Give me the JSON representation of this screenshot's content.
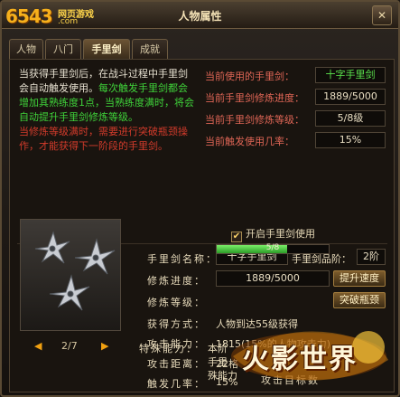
{
  "titlebar": {
    "logo_text": "6543",
    "logo_sub": "网页游戏",
    "logo_com": ".com",
    "title": "人物属性",
    "close_label": "✕"
  },
  "tabs": [
    {
      "label": "人物",
      "active": false
    },
    {
      "label": "八门",
      "active": false
    },
    {
      "label": "手里剑",
      "active": true
    },
    {
      "label": "成就",
      "active": false
    }
  ],
  "description": {
    "white": "当获得手里剑后，在战斗过程中手里剑会自动触发使用。",
    "green": "每次触发手里剑都会增加其熟练度1点，当熟练度满时，将会自动提升手里剑修炼等级。",
    "red": "当修炼等级满时，需要进行突破瓶颈操作，才能获得下一阶段的手里剑。"
  },
  "current": {
    "name_label": "当前使用的手里剑：",
    "name_value": "十字手里剑",
    "progress_label": "当前手里剑修炼进度：",
    "progress_value": "1889/5000",
    "level_label": "当前手里剑修炼等级：",
    "level_value": "5/8级",
    "trigger_label": "当前触发使用几率：",
    "trigger_value": "15%"
  },
  "enable_checkbox": {
    "checked": true,
    "label": "开启手里剑使用"
  },
  "detail": {
    "name_label": "手里剑名称：",
    "name_value": "十字手里剑",
    "grade_label": "手里剑品阶：",
    "grade_value": "2阶",
    "progress_label": "修炼进度：",
    "progress_value": "1889/5000",
    "speedup_button": "提升速度",
    "level_label": "修炼等级：",
    "level_value": "5/8",
    "level_fraction": 0.625,
    "breakthrough_button": "突破瓶颈",
    "obtain_label": "获得方式：",
    "obtain_value": "人物到达55级获得",
    "attack_label": "攻击能力：",
    "attack_value": "1815(15%的人物攻击力)",
    "range_label": "攻击距离：",
    "range_value": "22格",
    "trigger_label": "触发几率：",
    "trigger_value": "15%",
    "target_label": "攻击目标数",
    "special_label": "特殊能力：",
    "special_lines": [
      "本阶",
      "手里",
      "殊能力"
    ]
  },
  "pager": {
    "text": "2/7",
    "prev": "◀",
    "next": "▶"
  },
  "game_logo": {
    "text": "火影世界"
  },
  "colors": {
    "accent_gold": "#f0a010",
    "green_text": "#3fd23a",
    "red_text": "#d23b2b",
    "label_red": "#e06656"
  }
}
